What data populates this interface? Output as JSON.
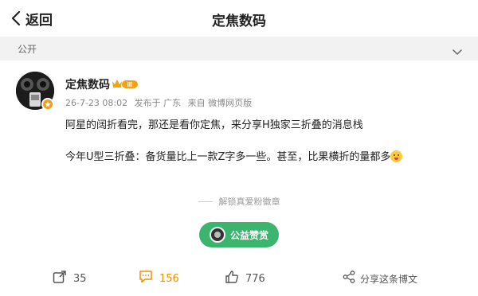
{
  "header": {
    "back_label": "返回",
    "title": "定焦数码"
  },
  "visibility": {
    "label": "公开"
  },
  "post": {
    "username": "定焦数码",
    "level_badge": "III",
    "time": "26-7-23 08:02",
    "location": "发布于 广东",
    "source": "来自 微博网页版",
    "paragraphs": [
      "阿星的阔折看完，那还是看你定焦，来分享H独家三折叠的消息栈",
      "今年U型三折叠：备货量比上一款Z字多一些。甚至，比果横折的量都多"
    ]
  },
  "fan_badge": {
    "label": "解锁真爱粉徽章"
  },
  "reward": {
    "label": "公益赞赏"
  },
  "actions": {
    "repost_count": "35",
    "comment_count": "156",
    "like_count": "776",
    "share_label": "分享这条博文"
  },
  "colors": {
    "accent": "#f09000",
    "reward_green": "#3bb56e",
    "verified_orange": "#f39c12"
  }
}
